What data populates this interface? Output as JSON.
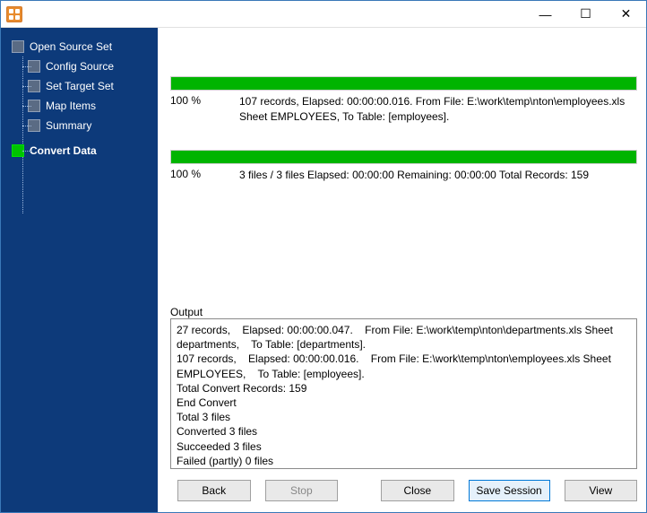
{
  "colors": {
    "sidebar_bg": "#0d3a7a",
    "progress_fill": "#00b400",
    "window_border": "#3a78b8",
    "primary_button_border": "#0078d7"
  },
  "titlebar": {
    "app_icon_name": "app-grid-icon",
    "min_label": "—",
    "max_label": "☐",
    "close_label": "✕"
  },
  "sidebar": {
    "root": {
      "label": "Open Source Set"
    },
    "items": [
      {
        "label": "Config Source"
      },
      {
        "label": "Set Target Set"
      },
      {
        "label": "Map Items"
      },
      {
        "label": "Summary"
      },
      {
        "label": "Convert Data",
        "active": true
      }
    ]
  },
  "progress": {
    "file": {
      "percent_label": "100 %",
      "details_line1": "107 records,    Elapsed: 00:00:00.016.    From File: E:\\work\\temp\\nton\\employees.xls Sheet EMPLOYEES,    To Table: [employees]."
    },
    "overall": {
      "percent_label": "100 %",
      "details": "3 files / 3 files    Elapsed: 00:00:00    Remaining: 00:00:00    Total Records: 159"
    }
  },
  "output": {
    "label": "Output",
    "text": "27 records,    Elapsed: 00:00:00.047.    From File: E:\\work\\temp\\nton\\departments.xls Sheet departments,    To Table: [departments].\n107 records,    Elapsed: 00:00:00.016.    From File: E:\\work\\temp\\nton\\employees.xls Sheet EMPLOYEES,    To Table: [employees].\nTotal Convert Records: 159\nEnd Convert\nTotal 3 files\nConverted 3 files\nSucceeded 3 files\nFailed (partly) 0 files"
  },
  "buttons": {
    "back": "Back",
    "stop": "Stop",
    "close": "Close",
    "save_session": "Save Session",
    "view": "View"
  }
}
